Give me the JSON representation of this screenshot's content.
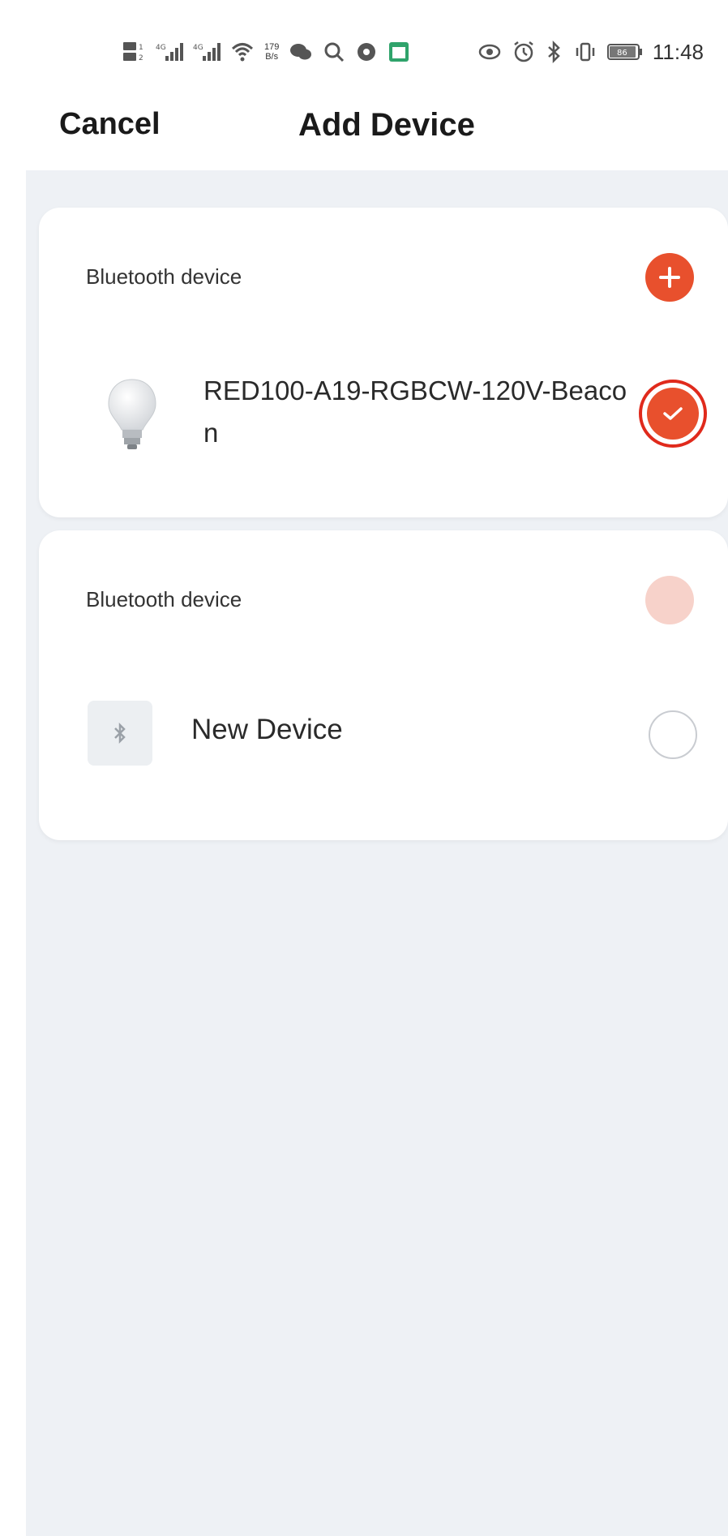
{
  "status_bar": {
    "speed_top": "179",
    "speed_unit": "B/s",
    "time": "11:48",
    "battery": "86"
  },
  "header": {
    "cancel_label": "Cancel",
    "title": "Add Device"
  },
  "devices": [
    {
      "section_label": "Bluetooth device",
      "name": "RED100-A19-RGBCW-120V-Beacon",
      "icon": "light-bulb-icon",
      "selected": true
    },
    {
      "section_label": "Bluetooth device",
      "name": "New Device",
      "icon": "bluetooth-icon",
      "selected": false
    }
  ],
  "colors": {
    "accent": "#e8502d",
    "accent_faded": "#f7d2ca",
    "background": "#eef1f5"
  }
}
